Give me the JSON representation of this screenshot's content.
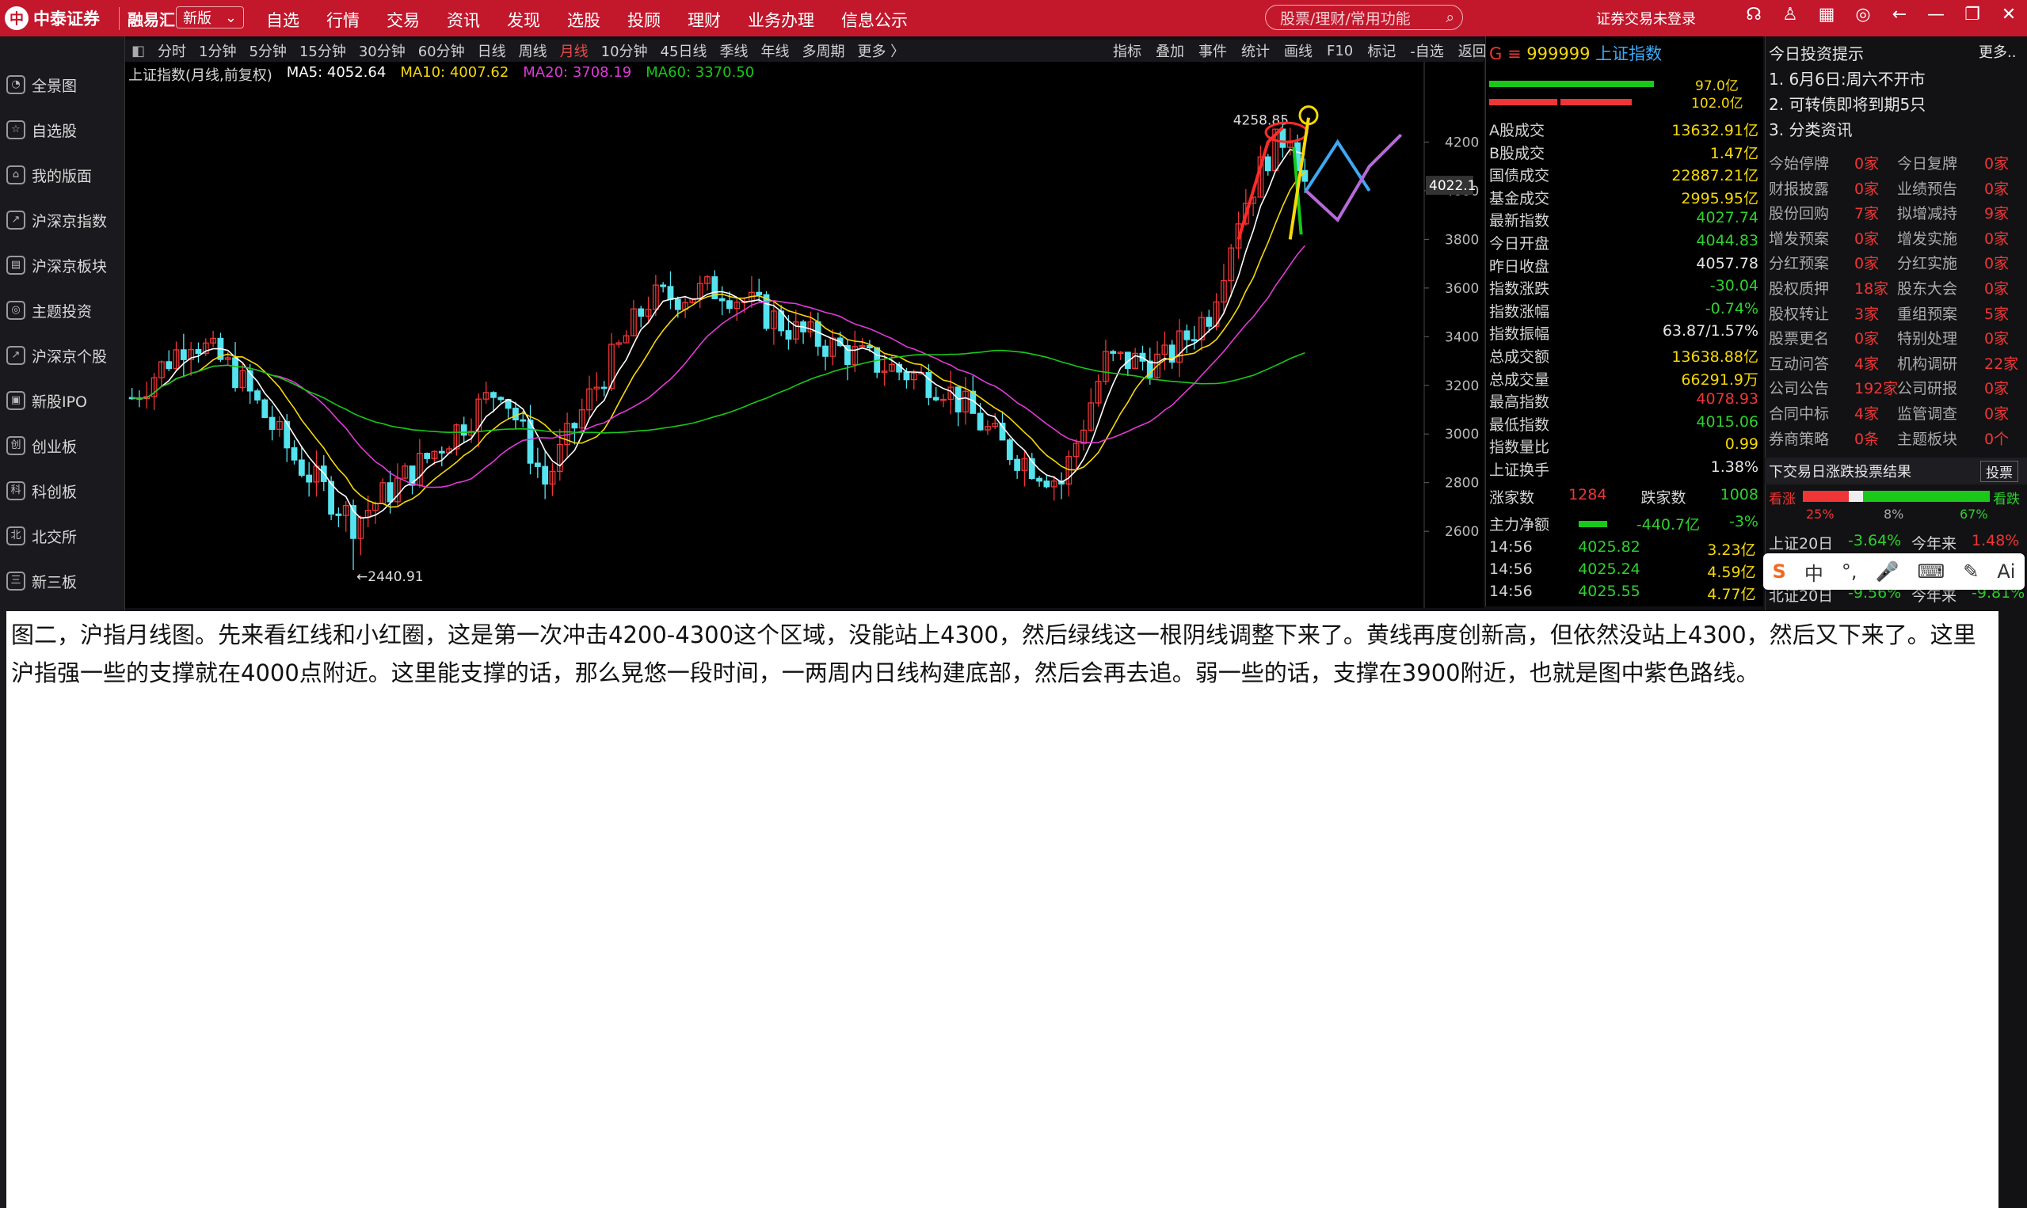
{
  "app": {
    "brand": "中泰证券",
    "app_name": "融易汇",
    "version_select": "新版",
    "menu": [
      "自选",
      "行情",
      "交易",
      "资讯",
      "发现",
      "选股",
      "投顾",
      "理财",
      "业务办理",
      "信息公示"
    ],
    "search_placeholder": "股票/理财/常用功能",
    "login_status": "证券交易未登录"
  },
  "sidebar": [
    "全景图",
    "自选股",
    "我的版面",
    "沪深京指数",
    "沪深京板块",
    "主题投资",
    "沪深京个股",
    "新股IPO",
    "创业板",
    "科创板",
    "北交所",
    "新三板"
  ],
  "periods": [
    "分时",
    "1分钟",
    "5分钟",
    "15分钟",
    "30分钟",
    "60分钟",
    "日线",
    "周线",
    "月线",
    "10分钟",
    "45日线",
    "季线",
    "年线",
    "多周期",
    "更多 〉"
  ],
  "active_period": "月线",
  "right_tools": [
    "指标",
    "叠加",
    "事件",
    "统计",
    "画线",
    "F10",
    "标记",
    "-自选",
    "返回"
  ],
  "chart_title": "上证指数(月线,前复权)",
  "ma": [
    {
      "label": "MA5: 4052.64",
      "color": "#ffffff"
    },
    {
      "label": "MA10: 4007.62",
      "color": "#f5d80a"
    },
    {
      "label": "MA20: 3708.19",
      "color": "#e03ad8"
    },
    {
      "label": "MA60: 3370.50",
      "color": "#19c819"
    }
  ],
  "chart_labels": {
    "high": "4258.85",
    "low": "←2440.91",
    "current": "4022.1"
  },
  "chart_data": {
    "type": "candlestick",
    "series": "上证指数(月线,前复权)",
    "ylim": [
      2600,
      4300
    ],
    "yticks": [
      2600,
      2800,
      3000,
      3200,
      3400,
      3600,
      3800,
      4000,
      4200
    ],
    "marked_high": 4258.85,
    "marked_low": 2440.91,
    "ma_lines": [
      "MA5",
      "MA10",
      "MA20",
      "MA60"
    ]
  },
  "index": {
    "code": "999999",
    "name": "上证指数",
    "bar_values": [
      "97.0亿",
      "102.0亿"
    ],
    "rows": [
      {
        "label": "A股成交",
        "value": "13632.91亿",
        "color": "#f5d80a"
      },
      {
        "label": "B股成交",
        "value": "1.47亿",
        "color": "#f5d80a"
      },
      {
        "label": "国债成交",
        "value": "22887.21亿",
        "color": "#f5d80a"
      },
      {
        "label": "基金成交",
        "value": "2995.95亿",
        "color": "#f5d80a"
      },
      {
        "label": "最新指数",
        "value": "4027.74",
        "color": "#2ed12e"
      },
      {
        "label": "今日开盘",
        "value": "4044.83",
        "color": "#2ed12e"
      },
      {
        "label": "昨日收盘",
        "value": "4057.78",
        "color": "#e6e6e6"
      },
      {
        "label": "指数涨跌",
        "value": "-30.04",
        "color": "#2ed12e"
      },
      {
        "label": "指数涨幅",
        "value": "-0.74%",
        "color": "#2ed12e"
      },
      {
        "label": "指数振幅",
        "value": "63.87/1.57%",
        "color": "#e6e6e6"
      },
      {
        "label": "总成交额",
        "value": "13638.88亿",
        "color": "#f5d80a"
      },
      {
        "label": "总成交量",
        "value": "66291.9万",
        "color": "#f5d80a"
      },
      {
        "label": "最高指数",
        "value": "4078.93",
        "color": "#ef3535"
      },
      {
        "label": "最低指数",
        "value": "4015.06",
        "color": "#2ed12e"
      },
      {
        "label": "指数量比",
        "value": "0.99",
        "color": "#f5d80a"
      },
      {
        "label": "上证换手",
        "value": "1.38%",
        "color": "#e6e6e6"
      }
    ],
    "up_label": "涨家数",
    "up_count": "1284",
    "down_label": "跌家数",
    "down_count": "1008",
    "main_flow_label": "主力净额",
    "main_flow_value": "-440.7亿",
    "main_flow_pct": "-3%",
    "ticks": [
      {
        "time": "14:56",
        "price": "4025.82",
        "vol": "3.23亿"
      },
      {
        "time": "14:56",
        "price": "4025.24",
        "vol": "4.59亿"
      },
      {
        "time": "14:56",
        "price": "4025.55",
        "vol": "4.77亿"
      }
    ]
  },
  "news": {
    "title": "今日投资提示",
    "more": "更多..",
    "items": [
      "1. 6月6日:周六不开市",
      "2. 可转债即将到期5只",
      "3. 分类资讯"
    ],
    "stats": [
      [
        "今始停牌",
        "0家",
        "今日复牌",
        "0家"
      ],
      [
        "财报披露",
        "0家",
        "业绩预告",
        "0家"
      ],
      [
        "股份回购",
        "7家",
        "拟增减持",
        "9家"
      ],
      [
        "增发预案",
        "0家",
        "增发实施",
        "0家"
      ],
      [
        "分红预案",
        "0家",
        "分红实施",
        "0家"
      ],
      [
        "股权质押",
        "18家",
        "股东大会",
        "0家"
      ],
      [
        "股权转让",
        "3家",
        "重组预案",
        "5家"
      ],
      [
        "股票更名",
        "0家",
        "特别处理",
        "0家"
      ],
      [
        "互动问答",
        "4家",
        "机构调研",
        "22家"
      ],
      [
        "公司公告",
        "192家",
        "公司研报",
        "0家"
      ],
      [
        "合同中标",
        "4家",
        "监管调查",
        "0家"
      ],
      [
        "券商策略",
        "0条",
        "主题板块",
        "0个"
      ]
    ],
    "vote_title": "下交易日涨跌投票结果",
    "vote_button": "投票",
    "vote_up": "看涨",
    "vote_down": "看跌",
    "vote_pcts": [
      "25%",
      "8%",
      "67%"
    ],
    "perf_rows": [
      [
        "上证20日",
        "-3.64%",
        "今年来",
        "1.48%"
      ],
      [
        "北证20日",
        "-9.56%",
        "今年来",
        "-9.81%"
      ]
    ]
  },
  "ime": [
    "S",
    "中",
    "°,",
    "🎤",
    "⌨",
    "✎",
    "Ai"
  ],
  "annotation": "图二，沪指月线图。先来看红线和小红圈，这是第一次冲击4200-4300这个区域，没能站上4300，然后绿线这一根阴线调整下来了。黄线再度创新高，但依然没站上4300，然后又下来了。这里沪指强一些的支撑就在4000点附近。这里能支撑的话，那么晃悠一段时间，一两周内日线构建底部，然后会再去追。弱一些的话，支撑在3900附近，也就是图中紫色路线。"
}
